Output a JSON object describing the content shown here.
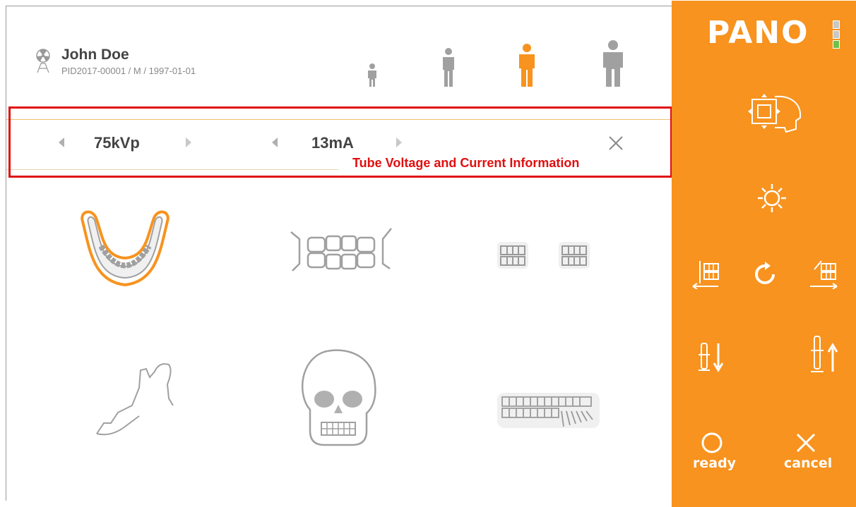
{
  "patient": {
    "name": "John Doe",
    "info": "PID2017-00001 / M / 1997-01-01"
  },
  "patient_types": [
    {
      "name": "child",
      "selected": false
    },
    {
      "name": "small-adult",
      "selected": false
    },
    {
      "name": "adult",
      "selected": true
    },
    {
      "name": "large-adult",
      "selected": false
    }
  ],
  "exposure": {
    "voltage": "75kVp",
    "current": "13mA"
  },
  "annotation": "Tube Voltage and Current Information",
  "programs": [
    {
      "name": "standard-pano-program",
      "selected": true
    },
    {
      "name": "bitewing-program",
      "selected": false
    },
    {
      "name": "partial-teeth-program",
      "selected": false
    },
    {
      "name": "tmj-program",
      "selected": false
    },
    {
      "name": "sinus-skull-program",
      "selected": false
    },
    {
      "name": "full-arch-program",
      "selected": false
    }
  ],
  "side": {
    "title": "PANO",
    "indicator_leds": [
      "gray",
      "gray",
      "green"
    ],
    "ready_label": "ready",
    "cancel_label": "cancel"
  },
  "colors": {
    "accent": "#f7931e",
    "selected_icon": "#f7931e",
    "inactive_icon": "#a0a0a0",
    "annotation": "#e01010",
    "led_green": "#6cc24a"
  }
}
